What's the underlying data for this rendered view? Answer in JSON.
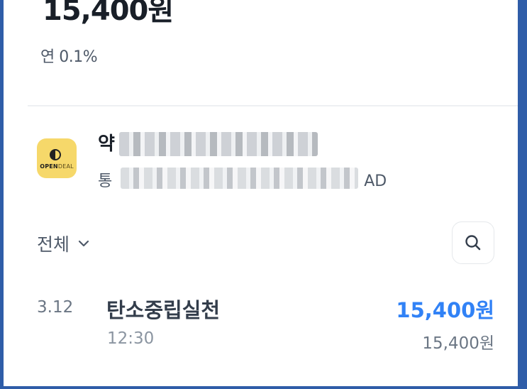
{
  "account": {
    "balance": "15,400원",
    "rate": "연 0.1%"
  },
  "ad": {
    "logo_line1": "OPEN",
    "logo_line2": "DEAL",
    "title_prefix": "약",
    "subtitle_prefix": "통",
    "subtitle_suffix": "AD"
  },
  "list": {
    "filter_label": "전체",
    "transactions": [
      {
        "date": "3.12",
        "name": "탄소중립실천",
        "time": "12:30",
        "amount": "15,400원",
        "balance_after": "15,400원"
      }
    ]
  },
  "colors": {
    "accent": "#3182f6",
    "frame": "#2f5da8",
    "ad_logo_bg": "#f6d86a"
  },
  "icons": {
    "search": "search-icon",
    "filter_chevron": "chevron-down-icon"
  }
}
